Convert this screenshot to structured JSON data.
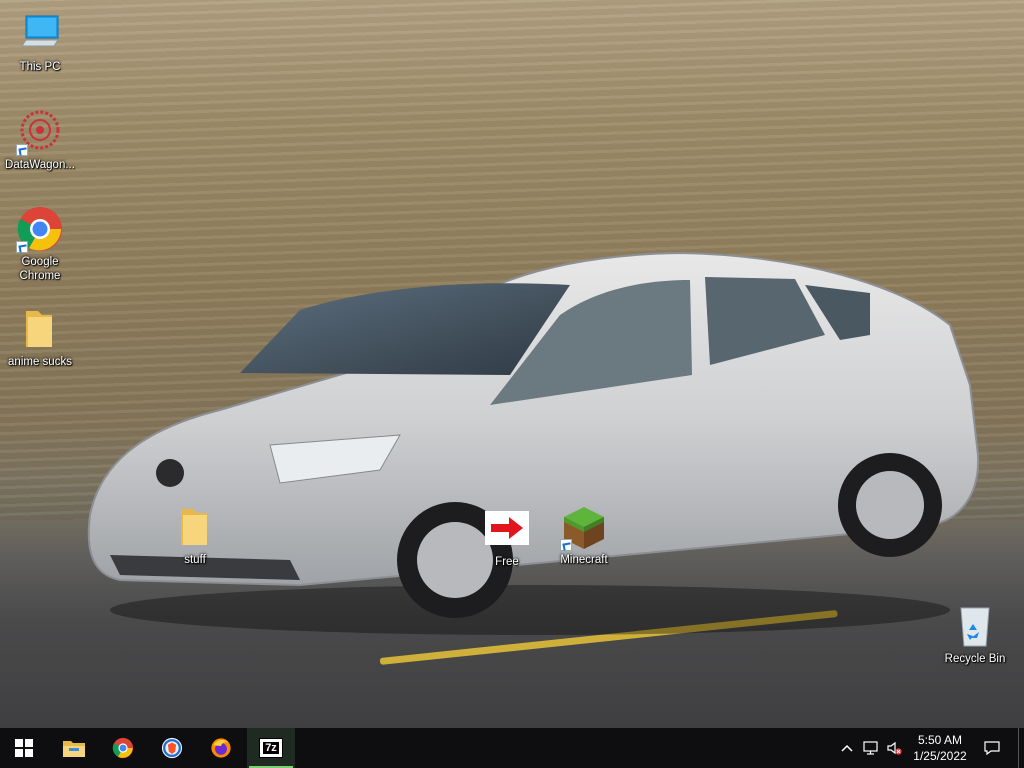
{
  "desktop": {
    "icons": [
      {
        "label": "This PC",
        "icon": "this-pc-icon",
        "shortcut": false
      },
      {
        "label": "DataWagon...",
        "icon": "datawagon-icon",
        "shortcut": true
      },
      {
        "label": "Google Chrome",
        "icon": "chrome-icon",
        "shortcut": true
      },
      {
        "label": "anime sucks",
        "icon": "folder-icon",
        "shortcut": false
      },
      {
        "label": "stuff",
        "icon": "folder-icon",
        "shortcut": false
      },
      {
        "label": "Free",
        "icon": "red-arrow-icon",
        "shortcut": false
      },
      {
        "label": "Minecraft",
        "icon": "minecraft-grass-block-icon",
        "shortcut": true
      },
      {
        "label": "Recycle Bin",
        "icon": "recycle-bin-icon",
        "shortcut": false
      }
    ]
  },
  "taskbar": {
    "pinned": [
      {
        "name": "start-button",
        "icon": "windows-logo-icon"
      },
      {
        "name": "file-explorer",
        "icon": "file-explorer-icon"
      },
      {
        "name": "google-chrome",
        "icon": "chrome-icon"
      },
      {
        "name": "brave-browser",
        "icon": "brave-icon"
      },
      {
        "name": "firefox",
        "icon": "firefox-icon"
      },
      {
        "name": "7-zip",
        "icon": "7zip-icon",
        "active": true,
        "label": "7z"
      }
    ],
    "tray": {
      "icons": [
        "chevron-up-icon",
        "network-icon",
        "volume-muted-icon"
      ],
      "time": "5:50 AM",
      "date": "1/25/2022"
    }
  },
  "colors": {
    "taskbar_bg": "#0e0e10",
    "active_indicator": "#7bd06f",
    "road_line": "#d6b63a"
  }
}
